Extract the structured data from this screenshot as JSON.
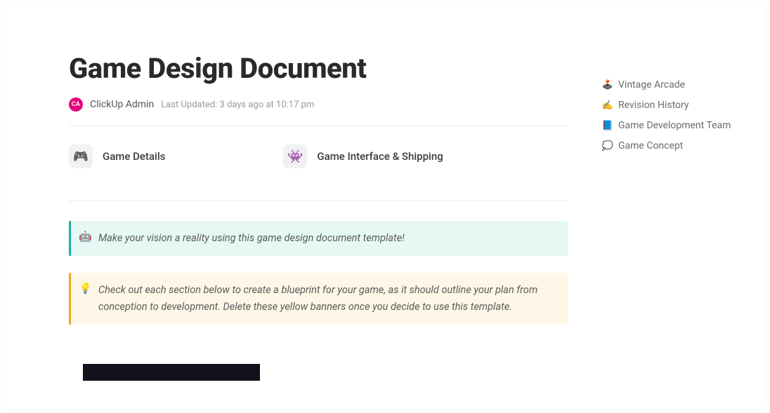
{
  "header": {
    "title": "Game Design Document",
    "author_initials": "CA",
    "author_name": "ClickUp Admin",
    "last_updated": "Last Updated: 3 days ago at 10:17 pm"
  },
  "sections": {
    "game_details": {
      "label": "Game Details",
      "icon": "🎮"
    },
    "interface_shipping": {
      "label": "Game Interface & Shipping",
      "icon": "👾"
    }
  },
  "banners": {
    "vision": {
      "icon": "🤖",
      "text": "Make your vision a reality using this game design document template!"
    },
    "blueprint": {
      "icon": "💡",
      "text": "Check out each section below to create a blueprint for your game, as it should outline your plan from conception to development. Delete these yellow banners once you decide to use this template."
    }
  },
  "toc": [
    {
      "icon": "🕹️",
      "label": "Vintage Arcade"
    },
    {
      "icon": "✍️",
      "label": "Revision History"
    },
    {
      "icon": "📘",
      "label": "Game Development Team"
    },
    {
      "icon": "💭",
      "label": "Game Concept"
    }
  ]
}
